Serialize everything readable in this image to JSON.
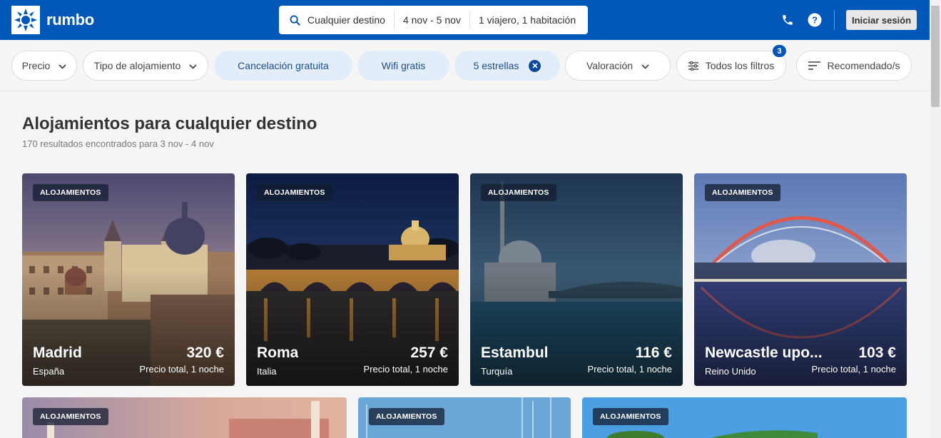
{
  "brand": {
    "name": "rumbo"
  },
  "search": {
    "destination": "Cualquier destino",
    "dates": "4 nov - 5 nov",
    "guests": "1 viajero, 1 habitación"
  },
  "header": {
    "login_label": "Iniciar sesión",
    "icons": [
      "phone-icon",
      "help-icon"
    ]
  },
  "filters": {
    "price": "Precio",
    "accommodation_type": "Tipo de alojamiento",
    "free_cancellation": "Cancelación gratuita",
    "free_wifi": "Wifi gratis",
    "five_stars": "5 estrellas",
    "rating": "Valoración",
    "all_filters": "Todos los filtros",
    "all_filters_count": "3",
    "sort": "Recomendado/s"
  },
  "page": {
    "title": "Alojamientos para cualquier destino",
    "subtitle": "170 resultados encontrados para 3 nov - 4 nov"
  },
  "cards": [
    {
      "tag": "ALOJAMIENTOS",
      "city": "Madrid",
      "country": "España",
      "price": "320 €",
      "price_note": "Precio total, 1 noche"
    },
    {
      "tag": "ALOJAMIENTOS",
      "city": "Roma",
      "country": "Italia",
      "price": "257 €",
      "price_note": "Precio total, 1 noche"
    },
    {
      "tag": "ALOJAMIENTOS",
      "city": "Estambul",
      "country": "Turquía",
      "price": "116 €",
      "price_note": "Precio total, 1 noche"
    },
    {
      "tag": "ALOJAMIENTOS",
      "city": "Newcastle upo...",
      "country": "Reino Unido",
      "price": "103 €",
      "price_note": "Precio total, 1 noche"
    },
    {
      "tag": "ALOJAMIENTOS"
    },
    {
      "tag": "ALOJAMIENTOS"
    },
    {
      "tag": "ALOJAMIENTOS"
    }
  ],
  "colors": {
    "brand": "#0057b8",
    "chip_active_bg": "#e3edf9",
    "chip_active_text": "#1a4f8b",
    "background": "#f5f5f5"
  }
}
